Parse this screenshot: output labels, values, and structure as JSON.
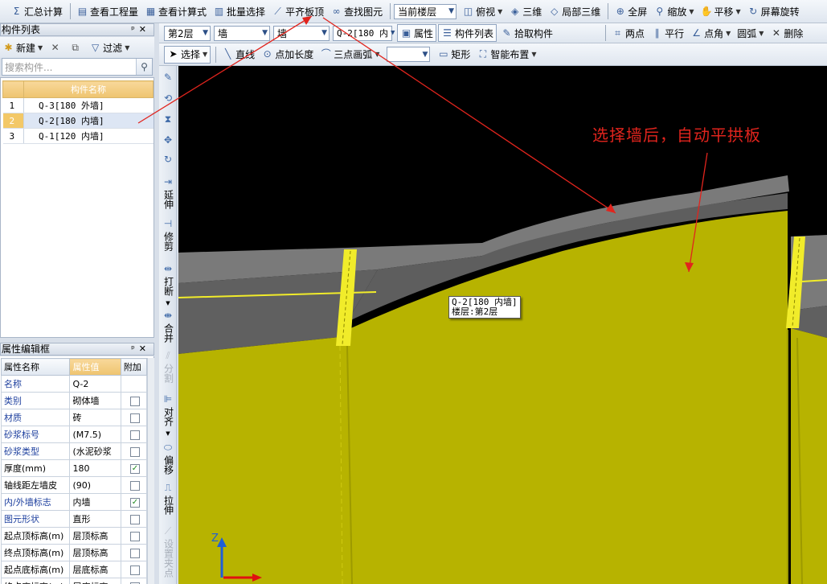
{
  "toolbar1": {
    "summary": "汇总计算",
    "view_project": "查看工程量",
    "view_formula": "查看计算式",
    "batch_select": "批量选择",
    "align_top": "平齐板顶",
    "find_element": "查找图元",
    "floor_scope": "当前楼层",
    "top_view": "俯视",
    "three_d": "三维",
    "partial_3d": "局部三维",
    "fullscreen": "全屏",
    "zoom": "缩放",
    "pan": "平移",
    "screen_rotate": "屏幕旋转"
  },
  "toolbar2": {
    "floor": "第2层",
    "category": "墙",
    "type": "墙",
    "component": "Q-2[180 内",
    "properties": "属性",
    "component_list": "构件列表",
    "pick_component": "拾取构件",
    "two_points": "两点",
    "parallel": "平行",
    "point_angle": "点角",
    "arc": "圆弧",
    "delete": "删除"
  },
  "toolbar3": {
    "select": "选择",
    "line": "直线",
    "point_length": "点加长度",
    "three_point_arc": "三点画弧",
    "blank_combo": "",
    "rectangle": "矩形",
    "smart_layout": "智能布置"
  },
  "component_panel": {
    "title": "构件列表",
    "new": "新建",
    "filter": "过滤",
    "search_placeholder": "搜索构件...",
    "column_header": "构件名称",
    "rows": [
      {
        "index": "1",
        "name": "Q-3[180 外墙]"
      },
      {
        "index": "2",
        "name": "Q-2[180 内墙]"
      },
      {
        "index": "3",
        "name": "Q-1[120 内墙]"
      }
    ]
  },
  "property_panel": {
    "title": "属性编辑框",
    "headers": {
      "name": "属性名称",
      "value": "属性值",
      "extra": "附加"
    },
    "rows": [
      {
        "name": "名称",
        "value": "Q-2",
        "checked": null
      },
      {
        "name": "类别",
        "value": "砌体墙",
        "checked": false
      },
      {
        "name": "材质",
        "value": "砖",
        "checked": false
      },
      {
        "name": "砂浆标号",
        "value": "(M7.5)",
        "checked": false
      },
      {
        "name": "砂浆类型",
        "value": "(水泥砂浆",
        "checked": false
      },
      {
        "name": "厚度(mm)",
        "value": "180",
        "checked": true
      },
      {
        "name": "轴线距左墙皮",
        "value": "(90)",
        "checked": false
      },
      {
        "name": "内/外墙标志",
        "value": "内墙",
        "checked": true
      },
      {
        "name": "图元形状",
        "value": "直形",
        "checked": false
      },
      {
        "name": "起点顶标高(m)",
        "value": "层顶标高",
        "checked": false
      },
      {
        "name": "终点顶标高(m)",
        "value": "层顶标高",
        "checked": false
      },
      {
        "name": "起点底标高(m)",
        "value": "层底标高",
        "checked": false
      },
      {
        "name": "终点底标高(m)",
        "value": "层底标高",
        "checked": false
      }
    ]
  },
  "vertical_toolbar": {
    "extend": "延伸",
    "trim": "修剪",
    "break": "打断",
    "merge": "合并",
    "split": "分割",
    "align": "对齐",
    "offset": "偏移",
    "stretch": "拉伸",
    "set_arch": "设置夹点"
  },
  "viewport": {
    "tooltip_line1": "Q-2[180 内墙]",
    "tooltip_line2": "楼层:第2层",
    "annotation": "选择墙后，自动平拱板",
    "axis_z": "Z"
  },
  "colors": {
    "slab": "#b7b300",
    "slab_dark": "#9d9a00",
    "wall_top": "#7a7a7a",
    "wall_side": "#606060",
    "column_yellow": "#f1ec2a",
    "annotation_red": "#e1241d",
    "header_orange": "#eec46f"
  }
}
